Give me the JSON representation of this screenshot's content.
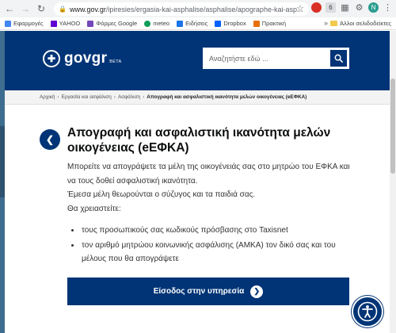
{
  "browser": {
    "url_host": "www.gov.gr",
    "url_path": "/ipiresies/ergasia-kai-asphalise/asphalise/apographe-kai-asp...",
    "ext_badge": "6",
    "profile_initial": "N"
  },
  "bookmarks": {
    "items": [
      {
        "label": "Εφαρμογές",
        "color": "#4285f4"
      },
      {
        "label": "YAHOO",
        "color": "#6001d2"
      },
      {
        "label": "Φόρμες Google",
        "color": "#7248b9"
      },
      {
        "label": "meteo",
        "color": "#0f9d58"
      },
      {
        "label": "Ειδήσεις",
        "color": "#1a73e8"
      },
      {
        "label": "Dropbox",
        "color": "#0061ff"
      },
      {
        "label": "Πρακτική",
        "color": "#e8710a"
      }
    ],
    "more": "»",
    "other": "Άλλοι σελιδοδείκτες"
  },
  "header": {
    "logo_text": "govgr",
    "beta": "BETA",
    "search_placeholder": "Αναζητήστε εδώ ...",
    "brand_color": "#003476"
  },
  "breadcrumb": {
    "items": [
      "Αρχική",
      "Εργασία και ασφάλιση",
      "Ασφάλιση"
    ],
    "current": "Απογραφή και ασφαλιστική ικανότητα μελών οικογένειας (eΕΦΚΑ)"
  },
  "main": {
    "title": "Απογραφή και ασφαλιστική ικανότητα μελών οικογένειας (eΕΦΚΑ)",
    "lead": "Μπορείτε να απογράψετε τα μέλη της οικογένειάς σας στο μητρώο του ΕΦΚΑ και να τους δοθεί ασφαλιστική ικανότητα.",
    "lead2": "Έμεσα μέλη θεωρούνται ο σύζυγος και τα παιδιά σας.",
    "needs_label": "Θα χρειαστείτε:",
    "requirements": [
      "τους προσωπικούς σας κωδικούς πρόσβασης στο Taxisnet",
      "τον αριθμό μητρώου κοινωνικής ασφάλισης (ΑΜΚΑ) τον δικό σας και του μέλους που θα απογράψετε"
    ],
    "cta_label": "Είσοδος στην υπηρεσία"
  }
}
